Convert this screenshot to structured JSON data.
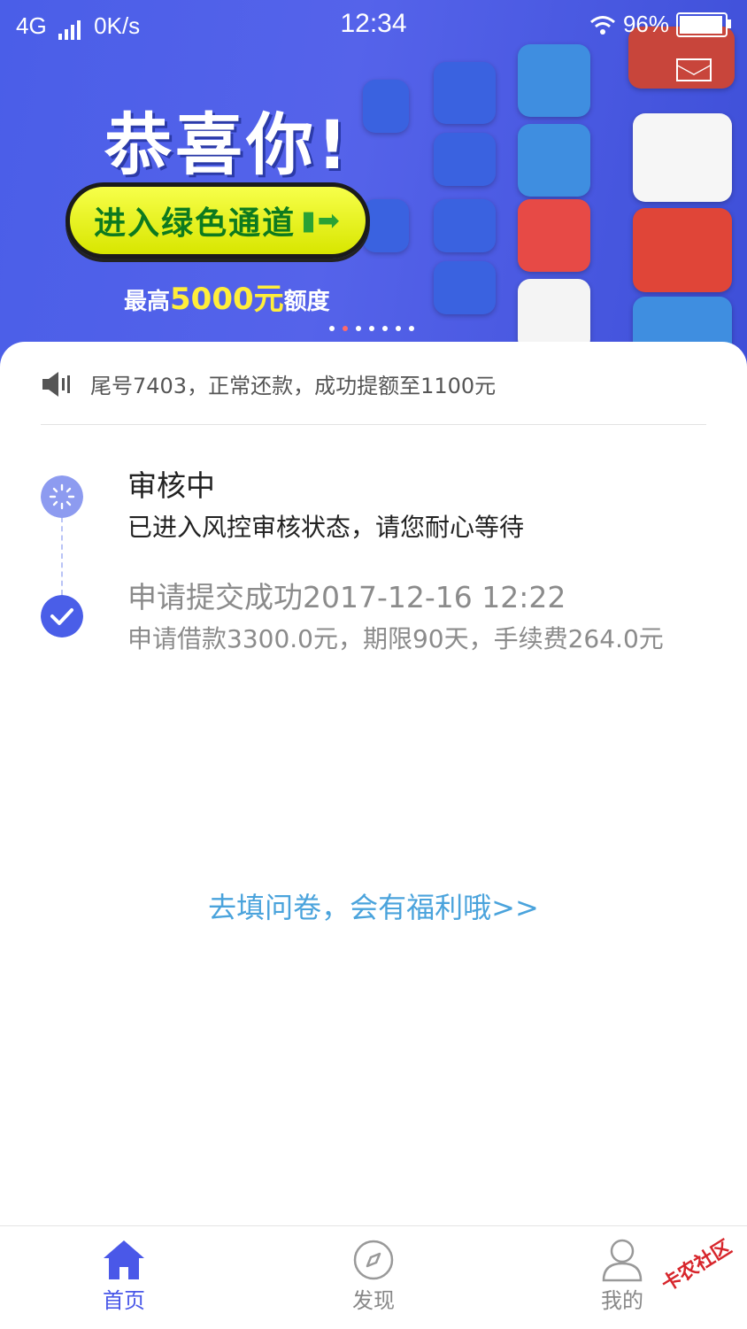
{
  "status_bar": {
    "network": "4G",
    "speed": "0K/s",
    "time": "12:34",
    "battery": "96%"
  },
  "banner": {
    "headline": "恭喜你!",
    "cta_label": "进入绿色通道",
    "limit_prefix": "最高",
    "limit_amount": "5000元",
    "limit_suffix": "额度",
    "page_count": 7,
    "active_page": 1
  },
  "notice": {
    "text": "尾号7403，正常还款，成功提额至1100元"
  },
  "timeline": [
    {
      "title": "审核中",
      "desc": "已进入风控审核状态，请您耐心等待",
      "state": "current"
    },
    {
      "title": "申请提交成功2017-12-16 12:22",
      "desc": "申请借款3300.0元，期限90天，手续费264.0元",
      "state": "done"
    }
  ],
  "survey_link": "去填问卷，会有福利哦>>",
  "tabs": [
    {
      "label": "首页",
      "icon": "home-icon",
      "active": true
    },
    {
      "label": "发现",
      "icon": "compass-icon",
      "active": false
    },
    {
      "label": "我的",
      "icon": "user-icon",
      "active": false
    }
  ],
  "watermark": "卡农社区",
  "colors": {
    "accent": "#4a58e8",
    "link": "#4aa3dc",
    "banner": "#4a5ee8"
  }
}
